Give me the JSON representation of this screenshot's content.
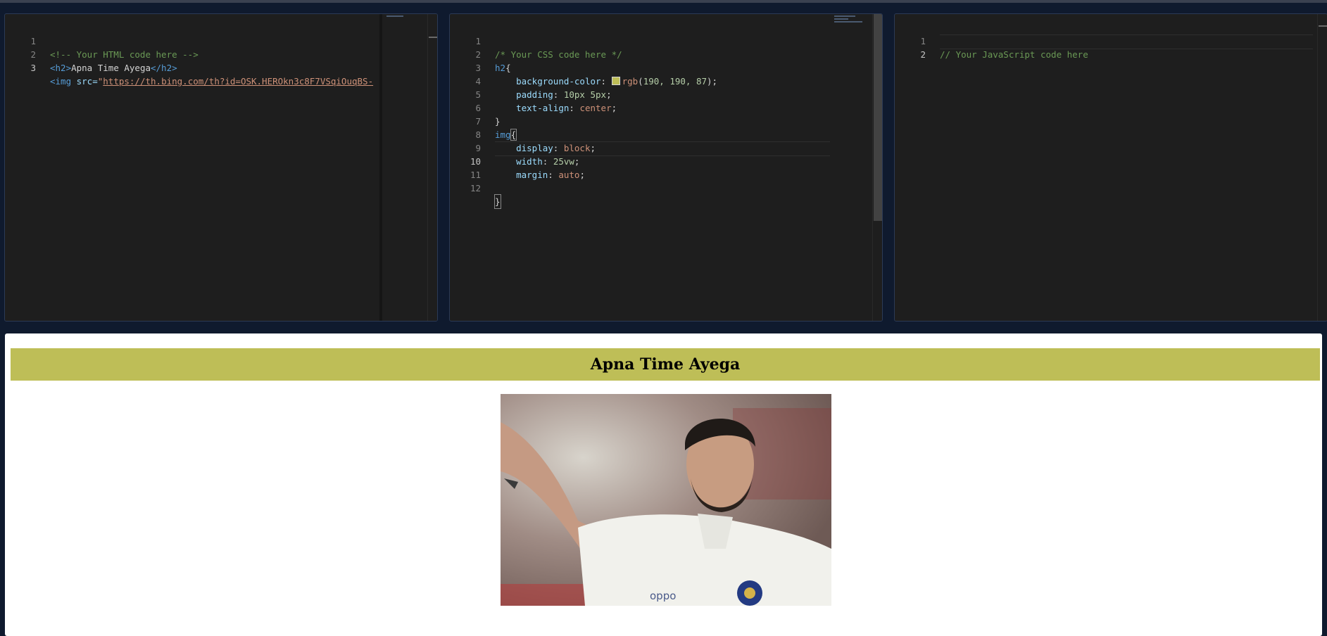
{
  "html_editor": {
    "lines": [
      {
        "n": "1"
      },
      {
        "n": "2"
      },
      {
        "n": "3"
      }
    ],
    "comment": "<!-- Your HTML code here -->",
    "h2_open": "<h2>",
    "h2_text": "Apna Time Ayega",
    "h2_close": "</h2>",
    "img_open": "<img",
    "img_attr": " src=",
    "img_quote": "\"",
    "img_src": "https://th.bing.com/th?id=OSK.HEROkn3c8F7VSqiOuqBS-"
  },
  "css_editor": {
    "line_numbers": [
      "1",
      "2",
      "3",
      "4",
      "5",
      "6",
      "7",
      "8",
      "9",
      "10",
      "11",
      "12"
    ],
    "comment": "/* Your CSS code here */",
    "sel_h2": "h2",
    "brace_open": "{",
    "brace_close": "}",
    "bg_prop": "background-color",
    "bg_func": "rgb",
    "bg_args": "190, 190, 87",
    "bg_color": "#bebe57",
    "pad_prop": "padding",
    "pad_val": "10px 5px",
    "ta_prop": "text-align",
    "ta_val": "center",
    "sel_img": "img",
    "disp_prop": "display",
    "disp_val": "block",
    "width_prop": "width",
    "width_val": "25vw",
    "margin_prop": "margin",
    "margin_val": "auto"
  },
  "js_editor": {
    "line_numbers": [
      "1",
      "2"
    ],
    "comment": "// Your JavaScript code here"
  },
  "preview": {
    "heading": "Apna Time Ayega",
    "heading_bg": "#bebe57",
    "image_alt": "photo of cricketer celebrating"
  }
}
